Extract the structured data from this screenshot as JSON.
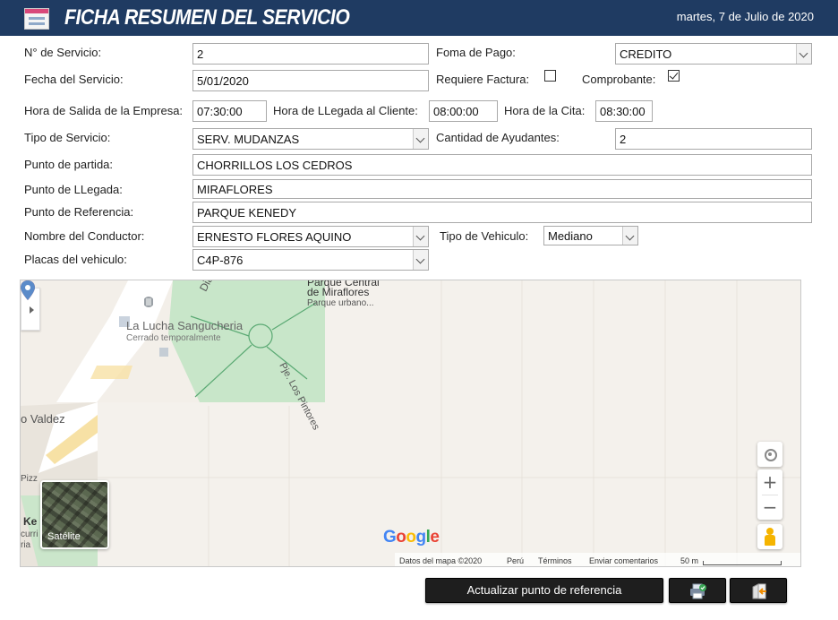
{
  "header": {
    "title": "FICHA RESUMEN DEL SERVICIO",
    "date": "martes, 7 de Julio de 2020",
    "colors": {
      "bar": "#1f3b62",
      "text": "#ffffff"
    }
  },
  "form": {
    "servicio_num": {
      "label": "N° de Servicio:",
      "value": "2"
    },
    "forma_pago": {
      "label": "Foma de Pago:",
      "value": "CREDITO"
    },
    "fecha_servicio": {
      "label": "Fecha del Servicio:",
      "value": "5/01/2020"
    },
    "requiere_factura": {
      "label": "Requiere Factura:",
      "checked": false
    },
    "comprobante": {
      "label": "Comprobante:",
      "checked": true
    },
    "hora_salida": {
      "label": "Hora de Salida de la Empresa:",
      "value": "07:30:00"
    },
    "hora_llegada": {
      "label": "Hora de  LLegada al Cliente:",
      "value": "08:00:00"
    },
    "hora_cita": {
      "label": "Hora de la Cita:",
      "value": "08:30:00"
    },
    "tipo_servicio": {
      "label": "Tipo de Servicio:",
      "value": "SERV. MUDANZAS"
    },
    "cantidad_ayudantes": {
      "label": "Cantidad de Ayudantes:",
      "value": "2"
    },
    "punto_partida": {
      "label": "Punto de partida:",
      "value": "CHORRILLOS LOS CEDROS"
    },
    "punto_llegada": {
      "label": "Punto de LLegada:",
      "value": "MIRAFLORES"
    },
    "punto_referencia": {
      "label": "Punto de Referencia:",
      "value": "PARQUE KENEDY"
    },
    "conductor": {
      "label": "Nombre del Conductor:",
      "value": "ERNESTO  FLORES AQUINO"
    },
    "tipo_vehiculo": {
      "label": "Tipo de Vehiculo:",
      "value": "Mediano"
    },
    "placas": {
      "label": "Placas del vehiculo:",
      "value": "C4P-876"
    }
  },
  "map": {
    "labels": {
      "park_title_line1": "Parque Central",
      "park_title_line2": "de Miraflores",
      "park_subtitle": "Parque urbano...",
      "restaurant": "La Lucha Sangucheria",
      "restaurant_status": "Cerrado temporalmente",
      "street_diag": "Diag",
      "street_pintores": "Pje. Los Pintores",
      "valdez": "o Valdez",
      "pizz": "Pizz",
      "ke": "Ke",
      "curri": "curri",
      "ria": "ria"
    },
    "satellite_label": "Satélite",
    "google_logo": "Google",
    "attribution": {
      "data": "Datos del mapa ©2020",
      "country": "Perú",
      "terms": "Términos",
      "feedback": "Enviar comentarios",
      "scale": "50 m"
    },
    "zoom_in": "+",
    "zoom_out": "−",
    "colors": {
      "park": "#c8e6c9",
      "road": "#ffffff",
      "base": "#f3efe9"
    }
  },
  "buttons": {
    "update_reference": "Actualizar punto de referencia",
    "print_icon": "print-check-icon",
    "exit_icon": "exit-door-icon"
  }
}
